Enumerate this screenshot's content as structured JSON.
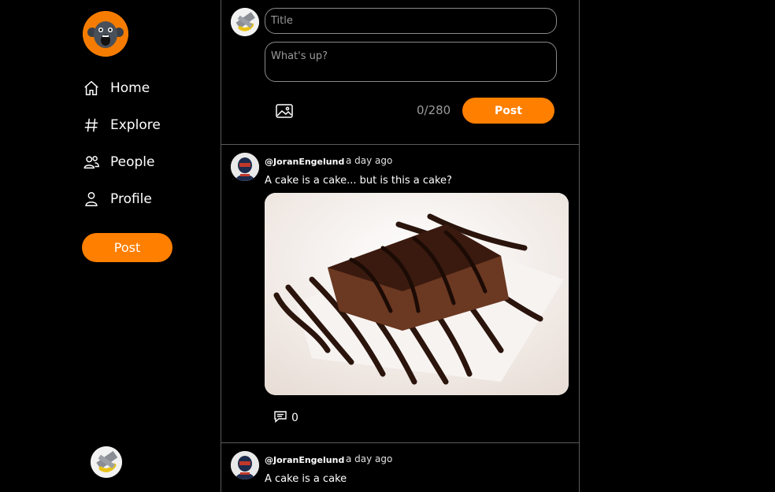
{
  "sidebar": {
    "nav": [
      {
        "label": "Home",
        "icon": "home-icon"
      },
      {
        "label": "Explore",
        "icon": "hash-icon"
      },
      {
        "label": "People",
        "icon": "people-icon"
      },
      {
        "label": "Profile",
        "icon": "profile-icon"
      }
    ],
    "post_label": "Post"
  },
  "composer": {
    "title_placeholder": "Title",
    "body_placeholder": "What's up?",
    "char_count": "0/280",
    "post_label": "Post"
  },
  "posts": [
    {
      "username": "@JoranEngelund",
      "time": "a day ago",
      "text": "A cake is a cake... but is this a cake?",
      "comments": "0"
    },
    {
      "username": "@JoranEngelund",
      "time": "a day ago",
      "text": "A cake is a cake"
    }
  ],
  "colors": {
    "accent": "#ff7f00",
    "background": "#000000",
    "border": "#5a5a5a"
  }
}
